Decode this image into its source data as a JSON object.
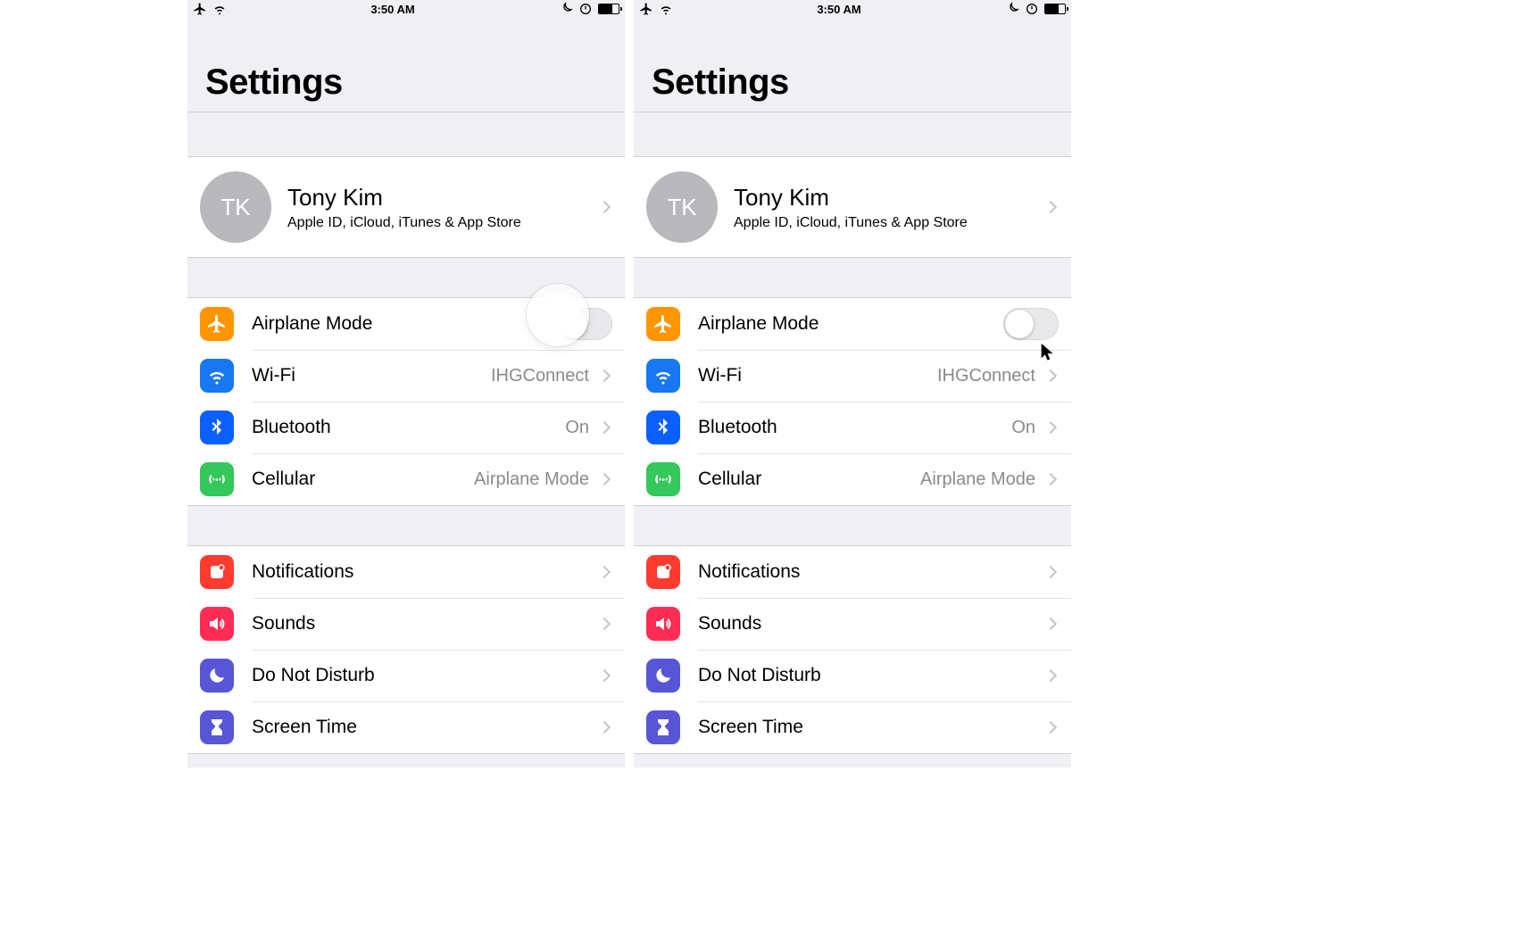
{
  "status": {
    "time": "3:50 AM"
  },
  "title": "Settings",
  "profile": {
    "initials": "TK",
    "name": "Tony Kim",
    "subtitle": "Apple ID, iCloud, iTunes & App Store"
  },
  "group1": {
    "airplane": {
      "label": "Airplane Mode"
    },
    "wifi": {
      "label": "Wi-Fi",
      "value": "IHGConnect"
    },
    "bluetooth": {
      "label": "Bluetooth",
      "value": "On"
    },
    "cellular": {
      "label": "Cellular",
      "value": "Airplane Mode"
    }
  },
  "group2": {
    "notifications": {
      "label": "Notifications"
    },
    "sounds": {
      "label": "Sounds"
    },
    "dnd": {
      "label": "Do Not Disturb"
    },
    "screentime": {
      "label": "Screen Time"
    }
  }
}
